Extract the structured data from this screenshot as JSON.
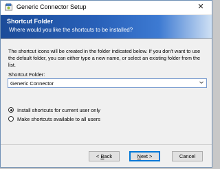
{
  "window": {
    "title": "Generic Connector Setup",
    "close_glyph": "✕"
  },
  "header": {
    "title": "Shortcut Folder",
    "subtitle": "Where would you like the shortcuts to be installed?"
  },
  "main": {
    "description": "The shortcut icons will be created in the folder indicated below. If you don't want to use the default folder, you can either type a new name, or select an existing folder from the list.",
    "folder_label": "Shortcut Folder:",
    "folder_value": "Generic Connector",
    "radios": [
      {
        "label": "Install shortcuts for current user only",
        "checked": true
      },
      {
        "label": "Make shortcuts available to all users",
        "checked": false
      }
    ]
  },
  "buttons": {
    "back_label_pre": "< ",
    "back_label_key": "B",
    "back_label_post": "ack",
    "next_label_key": "N",
    "next_label_post": "ext >",
    "cancel_label": "Cancel"
  },
  "icons": {
    "app": "installer-icon",
    "close": "close-icon",
    "dropdown": "chevron-down-icon"
  },
  "colors": {
    "header_start": "#1c4c99",
    "header_end": "#cfe0f4",
    "default_button_border": "#0078d7"
  }
}
